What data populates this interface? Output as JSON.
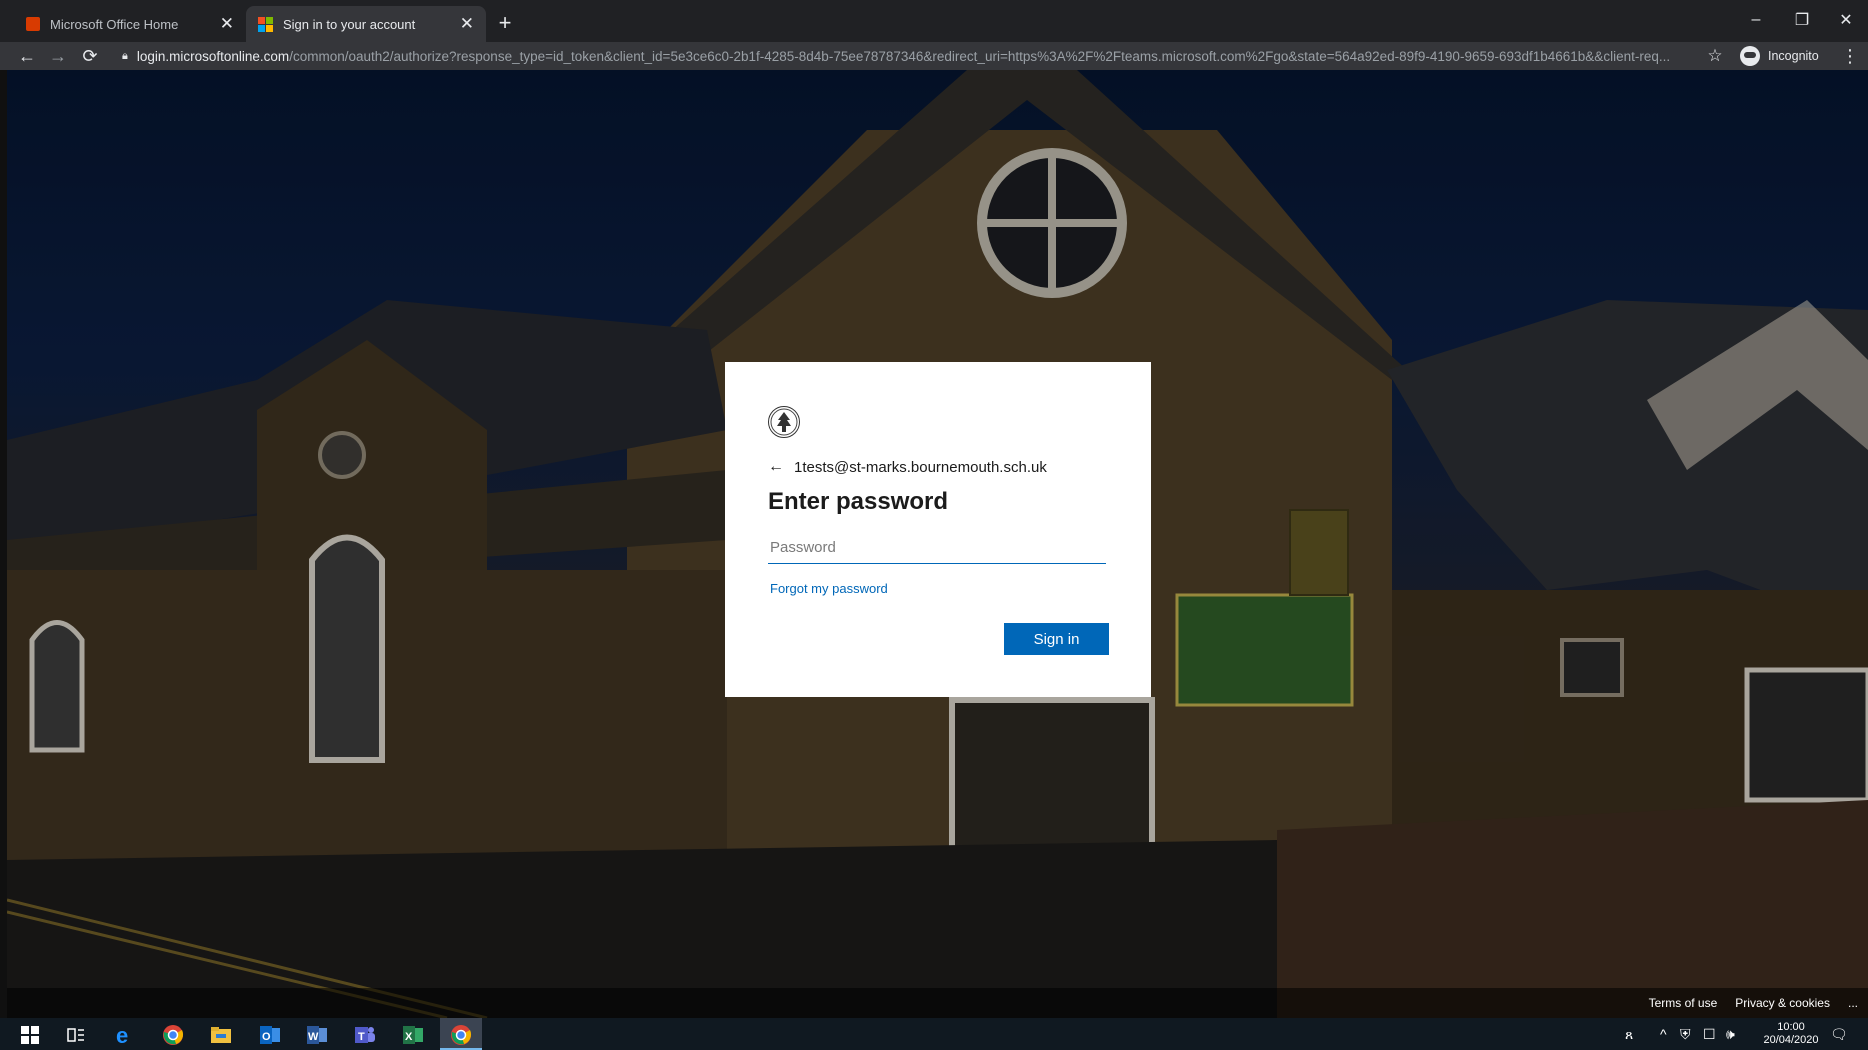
{
  "browser": {
    "tabs": [
      {
        "title": "Microsoft Office Home",
        "icon": "office-icon",
        "active": false
      },
      {
        "title": "Sign in to your account",
        "icon": "microsoft-icon",
        "active": true
      }
    ],
    "url_host": "login.microsoftonline.com",
    "url_path": "/common/oauth2/authorize?response_type=id_token&client_id=5e3ce6c0-2b1f-4285-8d4b-75ee78787346&redirect_uri=https%3A%2F%2Fteams.microsoft.com%2Fgo&state=564a92ed-89f9-4190-9659-693df1b4661b&&client-req...",
    "profile_label": "Incognito"
  },
  "signin": {
    "identity": "1tests@st-marks.bournemouth.sch.uk",
    "heading": "Enter password",
    "password_placeholder": "Password",
    "password_value": "",
    "forgot_link": "Forgot my password",
    "submit_label": "Sign in",
    "accent_color": "#0067b8"
  },
  "footer": {
    "terms": "Terms of use",
    "privacy": "Privacy & cookies",
    "more": "..."
  },
  "taskbar": {
    "apps": [
      "windows-start-icon",
      "task-view-icon",
      "edge-icon",
      "chrome-icon",
      "file-explorer-icon",
      "outlook-icon",
      "word-icon",
      "teams-icon",
      "excel-icon",
      "chrome-icon"
    ],
    "time": "10:00",
    "date": "20/04/2020"
  }
}
